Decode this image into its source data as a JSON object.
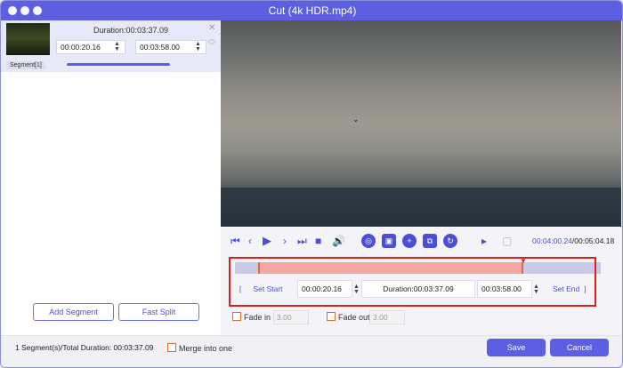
{
  "window": {
    "title": "Cut (4k HDR.mp4)"
  },
  "segment": {
    "duration_label": "Duration:00:03:37.09",
    "start_time": "00:00:20.16",
    "end_time": "00:03:58.00",
    "tag": "Segment[1]"
  },
  "left_buttons": {
    "add_segment": "Add Segment",
    "fast_split": "Fast Split"
  },
  "player": {
    "current_time": "00:04:00.24",
    "total_time": "/00:05:04.18"
  },
  "edit": {
    "set_start": "Set Start",
    "start_value": "00:00:20.16",
    "duration": "Duration:00:03:37.09",
    "end_value": "00:03:58.00",
    "set_end": "Set End"
  },
  "fade": {
    "fade_in_label": "Fade in",
    "fade_in_value": "3.00",
    "fade_out_label": "Fade out",
    "fade_out_value": "3.00"
  },
  "footer": {
    "summary": "1 Segment(s)/Total Duration: 00:03:37.09",
    "merge_label": "Merge into one",
    "save": "Save",
    "cancel": "Cancel"
  },
  "colors": {
    "accent": "#5b5fe0",
    "highlight_border": "#d9201a",
    "selection": "#f3a7a1"
  }
}
